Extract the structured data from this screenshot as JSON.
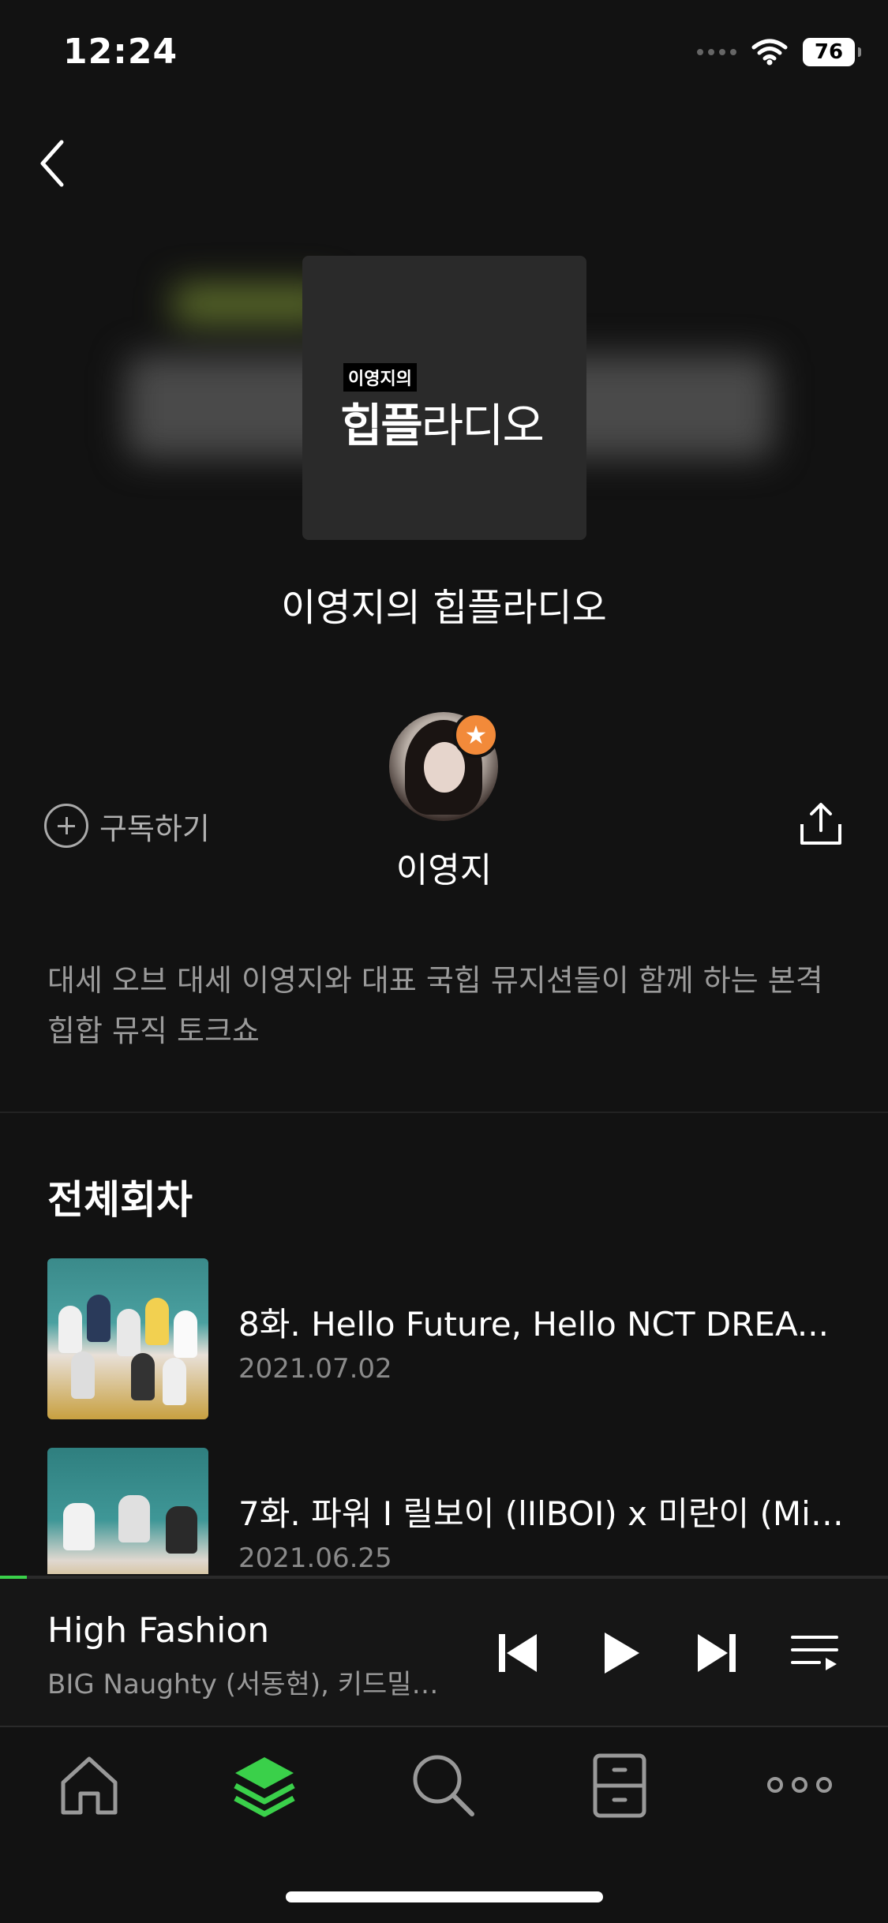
{
  "status_bar": {
    "time": "12:24",
    "battery": "76"
  },
  "show": {
    "cover_small_text": "이영지의",
    "cover_big_bold": "힙플",
    "cover_big_thin": "라디오",
    "title": "이영지의 힙플라디오",
    "host_name": "이영지",
    "subscribe_label": "구독하기",
    "description": "대세 오브 대세 이영지와 대표 국힙 뮤지션들이 함께 하는 본격 힙합 뮤직 토크쇼"
  },
  "episodes_section": {
    "title": "전체회차",
    "items": [
      {
        "title": "8화. Hello Future, Hello NCT DREA...",
        "date": "2021.07.02"
      },
      {
        "title": "7화. 파워 I 릴보이 (lIlBOI) x 미란이 (Mir...",
        "date": "2021.06.25"
      }
    ]
  },
  "player": {
    "track_title": "High Fashion",
    "track_artist": "BIG Naughty (서동현), 키드밀리...",
    "progress": 0.03
  },
  "colors": {
    "accent": "#3ad04a",
    "badge": "#f28a3a",
    "background": "#121212"
  },
  "tabbar": {
    "items": [
      "home-icon",
      "library-icon",
      "search-icon",
      "storage-icon",
      "more-icon"
    ],
    "active": "library-icon"
  }
}
